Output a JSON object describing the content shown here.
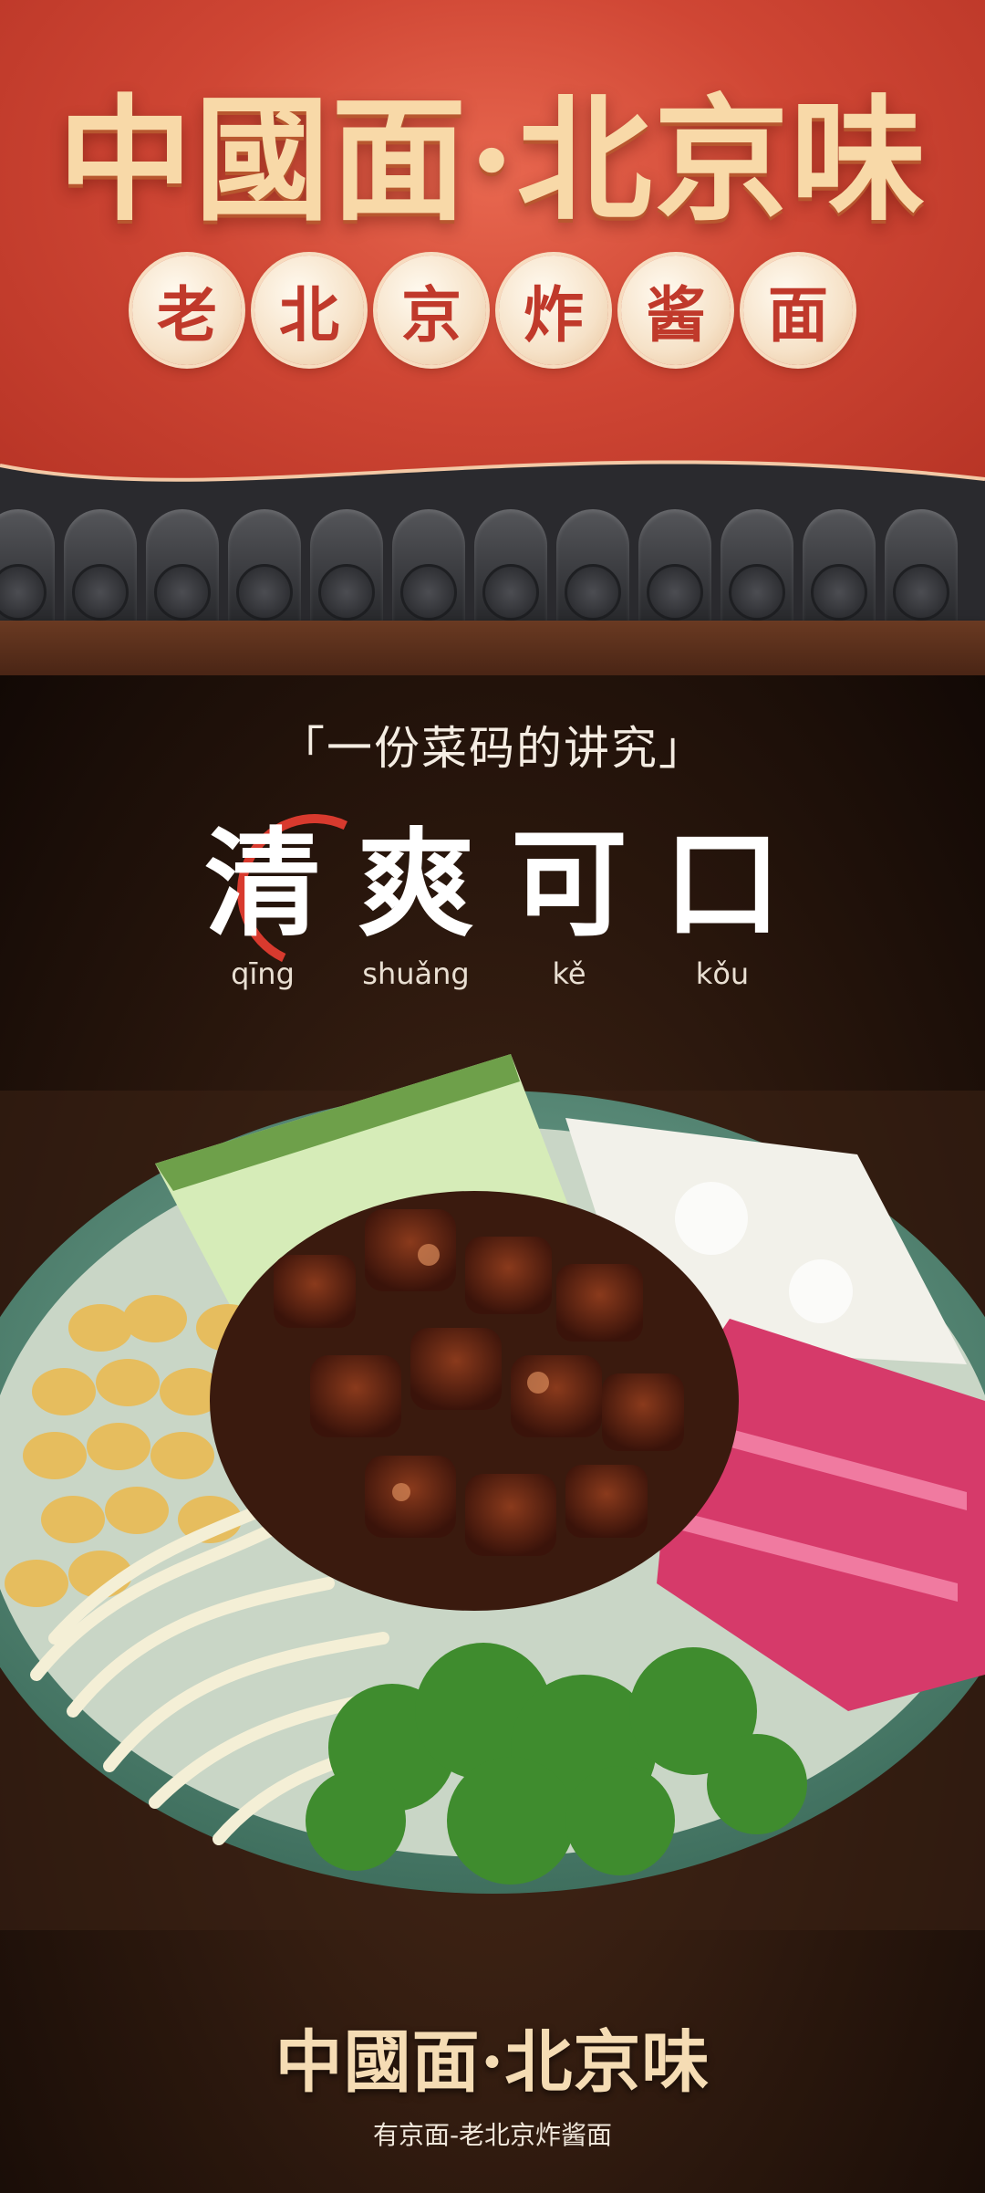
{
  "banner": {
    "main_title": "中國面·北京味",
    "sub_title_chars": [
      "老",
      "北",
      "京",
      "炸",
      "酱",
      "面"
    ]
  },
  "feature": {
    "tagline": "「一份菜码的讲究」",
    "words": [
      "清",
      "爽",
      "可",
      "口"
    ],
    "pinyin": [
      "qīng",
      "shuǎng",
      "kě",
      "kǒu"
    ]
  },
  "footer": {
    "title": "中國面·北京味",
    "subtitle": "有京面-老北京炸酱面"
  },
  "colors": {
    "banner_red": "#cf4634",
    "gold_text": "#f8d9a8",
    "medallion_text": "#c0392b",
    "accent_ring": "#d83a2e",
    "bowl_green": "#5d8f7c"
  },
  "icons": [
    "roof-tile-icon",
    "red-ring-accent-icon",
    "noodle-bowl-illustration"
  ]
}
